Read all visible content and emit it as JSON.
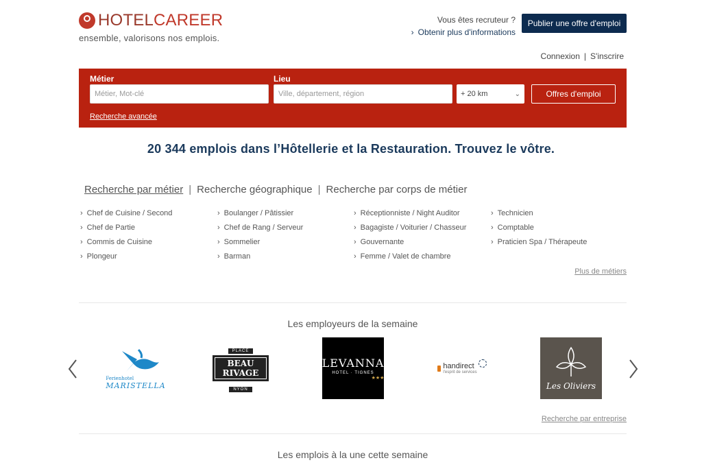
{
  "brand": {
    "name_part1": "HOTEL",
    "name_part2": "CAREER",
    "tagline": "ensemble, valorisons nos emplois.",
    "color": "#c0392b"
  },
  "recruiter": {
    "question": "Vous êtes recruteur ?",
    "more_info": "Obtenir plus d'informations",
    "publish_button": "Publier une offre d'emploi"
  },
  "auth": {
    "login": "Connexion",
    "separator": "|",
    "signup": "S'inscrire"
  },
  "search": {
    "metier_label": "Métier",
    "metier_placeholder": "Métier, Mot-clé",
    "lieu_label": "Lieu",
    "lieu_placeholder": "Ville, département, région",
    "radius_value": "+ 20 km",
    "submit_label": "Offres d'emploi",
    "advanced_link": "Recherche avancée",
    "panel_color": "#b92210"
  },
  "headline": "20 344 emplois dans l’Hôtellerie et la Restauration. Trouvez le vôtre.",
  "tabs": [
    {
      "label": "Recherche par métier",
      "active": true
    },
    {
      "label": "Recherche géographique",
      "active": false
    },
    {
      "label": "Recherche par corps de métier",
      "active": false
    }
  ],
  "tab_separator": "|",
  "job_columns": [
    [
      "Chef de Cuisine / Second",
      "Chef de Partie",
      "Commis de Cuisine",
      "Plongeur"
    ],
    [
      "Boulanger / Pâtissier",
      "Chef de Rang / Serveur",
      "Sommelier",
      "Barman"
    ],
    [
      "Réceptionniste / Night Auditor",
      "Bagagiste / Voiturier / Chasseur",
      "Gouvernante",
      "Femme / Valet de chambre"
    ],
    [
      "Technicien",
      "Comptable",
      "Praticien Spa / Thérapeute"
    ]
  ],
  "more_jobs_link": "Plus de métiers",
  "employers_section": {
    "title": "Les employeurs de la semaine",
    "employers": [
      {
        "line1": "Ferienhotel",
        "line2": "MARISTELLA",
        "icon": "fish-icon",
        "color": "#1e88c8"
      },
      {
        "line1": "PLACE",
        "line2": "BEAU RIVAGE",
        "line3": "NYON"
      },
      {
        "line1": "LEVANNA",
        "line2": "HOTEL · TIGNES",
        "stars": "★★★"
      },
      {
        "line1": "handirect",
        "line2": "l'esprit de services"
      },
      {
        "line1": "Les Oliviers",
        "icon": "olive-leaf-icon"
      }
    ],
    "company_search_link": "Recherche par entreprise"
  },
  "featured_section": {
    "title": "Les emplois à la une cette semaine"
  },
  "colors": {
    "navy": "#0d2b4f",
    "headline_blue": "#1b3a5c"
  }
}
